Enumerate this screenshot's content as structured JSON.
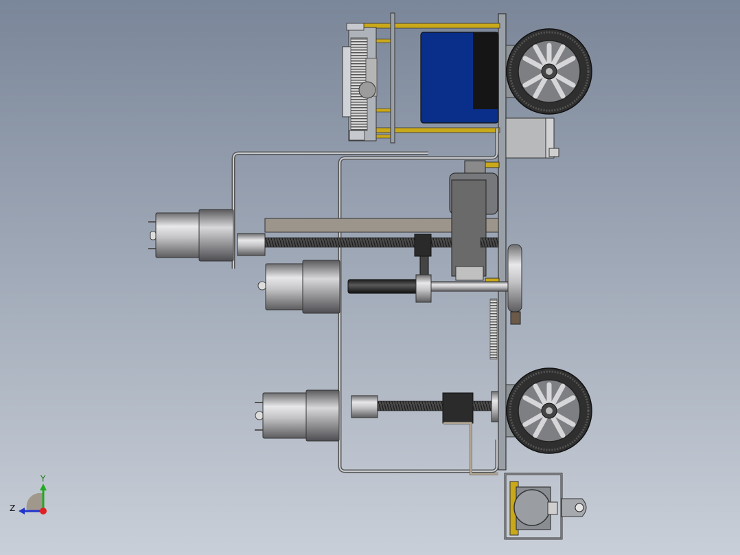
{
  "viewport": {
    "background_top": "#7a8699",
    "background_bottom": "#c9cfd8"
  },
  "triad": {
    "y_label": "Y",
    "z_label": "Z",
    "x_color": "#e02020",
    "y_color": "#22aa22",
    "z_color": "#2233cc"
  },
  "colors": {
    "battery_blue": "#0a2f8a",
    "standoff_gold": "#c9a81a",
    "frame_gray": "#8d939b",
    "motor_silver": "#b9b9bb",
    "dark_part": "#2a2a2a",
    "wheel_tire": "#3a3a3a"
  }
}
